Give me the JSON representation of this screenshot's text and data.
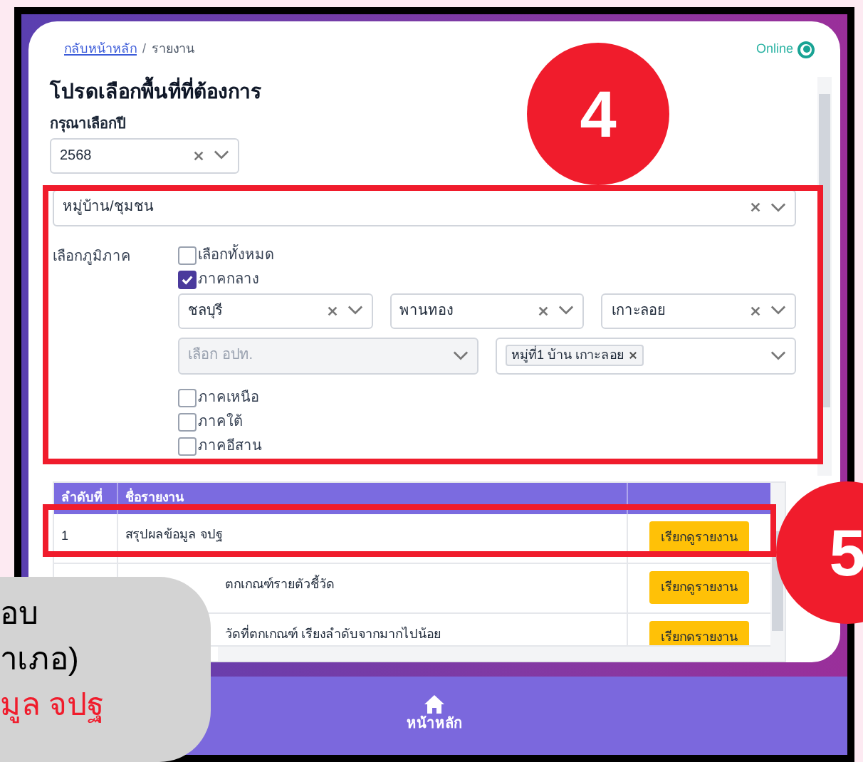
{
  "breadcrumb": {
    "link": "กลับหน้าหลัก",
    "separator": "/",
    "current": "รายงาน"
  },
  "status": {
    "label": "Online",
    "online": true
  },
  "heading": "โปรดเลือกพื้นที่ที่ต้องการ",
  "year": {
    "label": "กรุณาเลือกปี",
    "value": "2568"
  },
  "level_select": {
    "value": "หมู่บ้าน/ชุมชน"
  },
  "region": {
    "label": "เลือกภูมิภาค",
    "select_all": {
      "label": "เลือกทั้งหมด",
      "checked": false
    },
    "regions": [
      {
        "label": "ภาคกลาง",
        "checked": true,
        "filters": {
          "province": "ชลบุรี",
          "district": "พานทอง",
          "subdistrict": "เกาะลอย",
          "lao_placeholder": "เลือก อปท.",
          "villages": [
            "หมู่ที่1 บ้าน เกาะลอย"
          ]
        }
      },
      {
        "label": "ภาคเหนือ",
        "checked": false
      },
      {
        "label": "ภาคใต้",
        "checked": false
      },
      {
        "label": "ภาคอีสาน",
        "checked": false
      }
    ]
  },
  "table": {
    "columns": [
      "ลำดับที่",
      "ชื่อรายงาน"
    ],
    "rows": [
      {
        "index": "1",
        "name": "สรุปผลข้อมูล จปฐ",
        "action": "เรียกดูรายงาน"
      },
      {
        "name": "ตกเกณฑ์รายตัวชี้วัด",
        "action": "เรียกดูรายงาน"
      },
      {
        "name": "วัดที่ตกเกณฑ์ เรียงลำดับจากมากไปน้อย",
        "action": "เรียกดรายงาน"
      }
    ]
  },
  "bottom_nav": {
    "label": "หน้าหลัก"
  },
  "callouts": [
    {
      "number": "4"
    },
    {
      "number": "5"
    }
  ],
  "note_bubble": {
    "lines": [
      {
        "text": "อบ",
        "highlight": false
      },
      {
        "text": "าเภอ)",
        "highlight": false
      },
      {
        "text": "มูล จปฐ",
        "highlight": true
      }
    ]
  }
}
